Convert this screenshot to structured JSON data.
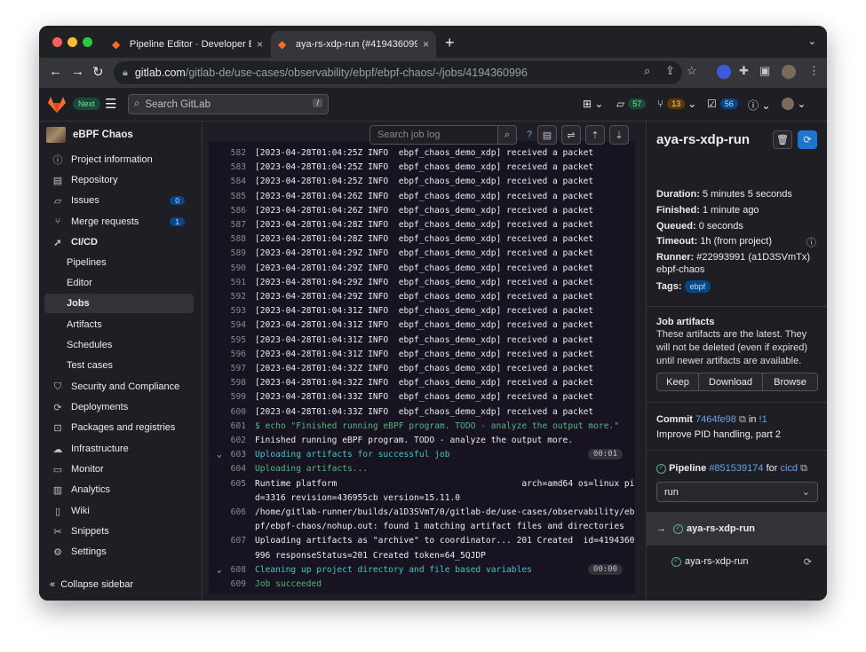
{
  "browser": {
    "tabs": [
      {
        "title": "Pipeline Editor · Developer Eva",
        "close": "×"
      },
      {
        "title": "aya-rs-xdp-run (#4194360996",
        "close": "×"
      }
    ],
    "new_tab": "+",
    "url_host": "gitlab.com",
    "url_path": "/gitlab-de/use-cases/observability/ebpf/ebpf-chaos/-/jobs/4194360996"
  },
  "header": {
    "next_badge": "Next",
    "search_placeholder": "Search GitLab",
    "search_shortcut": "/",
    "issues_count": "57",
    "mr_count": "13",
    "todo_count": "56"
  },
  "sidebar": {
    "project_name": "eBPF Chaos",
    "items": [
      {
        "label": "Project information",
        "icon": "info-icon"
      },
      {
        "label": "Repository",
        "icon": "doc-icon"
      },
      {
        "label": "Issues",
        "icon": "issues-icon",
        "count": "0"
      },
      {
        "label": "Merge requests",
        "icon": "merge-icon",
        "count": "1"
      },
      {
        "label": "CI/CD",
        "icon": "rocket-icon"
      },
      {
        "label": "Pipelines"
      },
      {
        "label": "Editor"
      },
      {
        "label": "Jobs"
      },
      {
        "label": "Artifacts"
      },
      {
        "label": "Schedules"
      },
      {
        "label": "Test cases"
      },
      {
        "label": "Security and Compliance",
        "icon": "shield-icon"
      },
      {
        "label": "Deployments",
        "icon": "deploy-icon"
      },
      {
        "label": "Packages and registries",
        "icon": "package-icon"
      },
      {
        "label": "Infrastructure",
        "icon": "cloud-icon"
      },
      {
        "label": "Monitor",
        "icon": "monitor-icon"
      },
      {
        "label": "Analytics",
        "icon": "chart-icon"
      },
      {
        "label": "Wiki",
        "icon": "book-icon"
      },
      {
        "label": "Snippets",
        "icon": "scissors-icon"
      },
      {
        "label": "Settings",
        "icon": "gear-icon"
      }
    ],
    "collapse_label": "Collapse sidebar"
  },
  "log": {
    "search_placeholder": "Search job log",
    "lines": [
      {
        "n": "582",
        "t": "[2023-04-28T01:04:25Z INFO  ebpf_chaos_demo_xdp] received a packet"
      },
      {
        "n": "583",
        "t": "[2023-04-28T01:04:25Z INFO  ebpf_chaos_demo_xdp] received a packet"
      },
      {
        "n": "584",
        "t": "[2023-04-28T01:04:25Z INFO  ebpf_chaos_demo_xdp] received a packet"
      },
      {
        "n": "585",
        "t": "[2023-04-28T01:04:26Z INFO  ebpf_chaos_demo_xdp] received a packet"
      },
      {
        "n": "586",
        "t": "[2023-04-28T01:04:26Z INFO  ebpf_chaos_demo_xdp] received a packet"
      },
      {
        "n": "587",
        "t": "[2023-04-28T01:04:28Z INFO  ebpf_chaos_demo_xdp] received a packet"
      },
      {
        "n": "588",
        "t": "[2023-04-28T01:04:28Z INFO  ebpf_chaos_demo_xdp] received a packet"
      },
      {
        "n": "589",
        "t": "[2023-04-28T01:04:29Z INFO  ebpf_chaos_demo_xdp] received a packet"
      },
      {
        "n": "590",
        "t": "[2023-04-28T01:04:29Z INFO  ebpf_chaos_demo_xdp] received a packet"
      },
      {
        "n": "591",
        "t": "[2023-04-28T01:04:29Z INFO  ebpf_chaos_demo_xdp] received a packet"
      },
      {
        "n": "592",
        "t": "[2023-04-28T01:04:29Z INFO  ebpf_chaos_demo_xdp] received a packet"
      },
      {
        "n": "593",
        "t": "[2023-04-28T01:04:31Z INFO  ebpf_chaos_demo_xdp] received a packet"
      },
      {
        "n": "594",
        "t": "[2023-04-28T01:04:31Z INFO  ebpf_chaos_demo_xdp] received a packet"
      },
      {
        "n": "595",
        "t": "[2023-04-28T01:04:31Z INFO  ebpf_chaos_demo_xdp] received a packet"
      },
      {
        "n": "596",
        "t": "[2023-04-28T01:04:31Z INFO  ebpf_chaos_demo_xdp] received a packet"
      },
      {
        "n": "597",
        "t": "[2023-04-28T01:04:32Z INFO  ebpf_chaos_demo_xdp] received a packet"
      },
      {
        "n": "598",
        "t": "[2023-04-28T01:04:32Z INFO  ebpf_chaos_demo_xdp] received a packet"
      },
      {
        "n": "599",
        "t": "[2023-04-28T01:04:33Z INFO  ebpf_chaos_demo_xdp] received a packet"
      },
      {
        "n": "600",
        "t": "[2023-04-28T01:04:33Z INFO  ebpf_chaos_demo_xdp] received a packet"
      },
      {
        "n": "601",
        "t": "$ echo \"Finished running eBPF program. TODO - analyze the output more.\"",
        "cls": "green"
      },
      {
        "n": "602",
        "t": "Finished running eBPF program. TODO - analyze the output more."
      },
      {
        "n": "603",
        "t": "Uploading artifacts for successful job",
        "cls": "cyan",
        "section": true,
        "dur": "00:01"
      },
      {
        "n": "604",
        "t": "Uploading artifacts...",
        "cls": "green"
      },
      {
        "n": "605",
        "t": "Runtime platform                                    arch=amd64 os=linux pi"
      },
      {
        "n": "",
        "t": "d=3316 revision=436955cb version=15.11.0"
      },
      {
        "n": "606",
        "t": "/home/gitlab-runner/builds/a1D3SVmT/0/gitlab-de/use-cases/observability/eb"
      },
      {
        "n": "",
        "t": "pf/ebpf-chaos/nohup.out: found 1 matching artifact files and directories"
      },
      {
        "n": "607",
        "t": "Uploading artifacts as \"archive\" to coordinator... 201 Created  id=4194360"
      },
      {
        "n": "",
        "t": "996 responseStatus=201 Created token=64_5QJDP"
      },
      {
        "n": "608",
        "t": "Cleaning up project directory and file based variables",
        "cls": "cyan",
        "section": true,
        "dur": "00:00"
      },
      {
        "n": "609",
        "t": "Job succeeded",
        "cls": "green"
      }
    ]
  },
  "job": {
    "title": "aya-rs-xdp-run",
    "duration_label": "Duration:",
    "duration": "5 minutes 5 seconds",
    "finished_label": "Finished:",
    "finished": "1 minute ago",
    "queued_label": "Queued:",
    "queued": "0 seconds",
    "timeout_label": "Timeout:",
    "timeout": "1h (from project)",
    "runner_label": "Runner:",
    "runner": "#22993991 (a1D3SVmTx)",
    "runner_name": "ebpf-chaos",
    "tags_label": "Tags:",
    "tag": "ebpf",
    "artifacts_title": "Job artifacts",
    "artifacts_desc_1": "These artifacts are the latest. They",
    "artifacts_desc_2": "will not be deleted (even if expired)",
    "artifacts_desc_3": "until newer artifacts are available.",
    "keep": "Keep",
    "download": "Download",
    "browse": "Browse",
    "commit_label": "Commit",
    "commit_sha": "7464fe98",
    "in_label": "in",
    "mr_ref": "!1",
    "commit_msg": "Improve PID handling, part 2",
    "pipeline_label": "Pipeline",
    "pipeline_id": "#851539174",
    "for_label": "for",
    "ref": "cicd",
    "stage": "run",
    "jobs": [
      "aya-rs-xdp-run",
      "aya-rs-xdp-run"
    ]
  }
}
